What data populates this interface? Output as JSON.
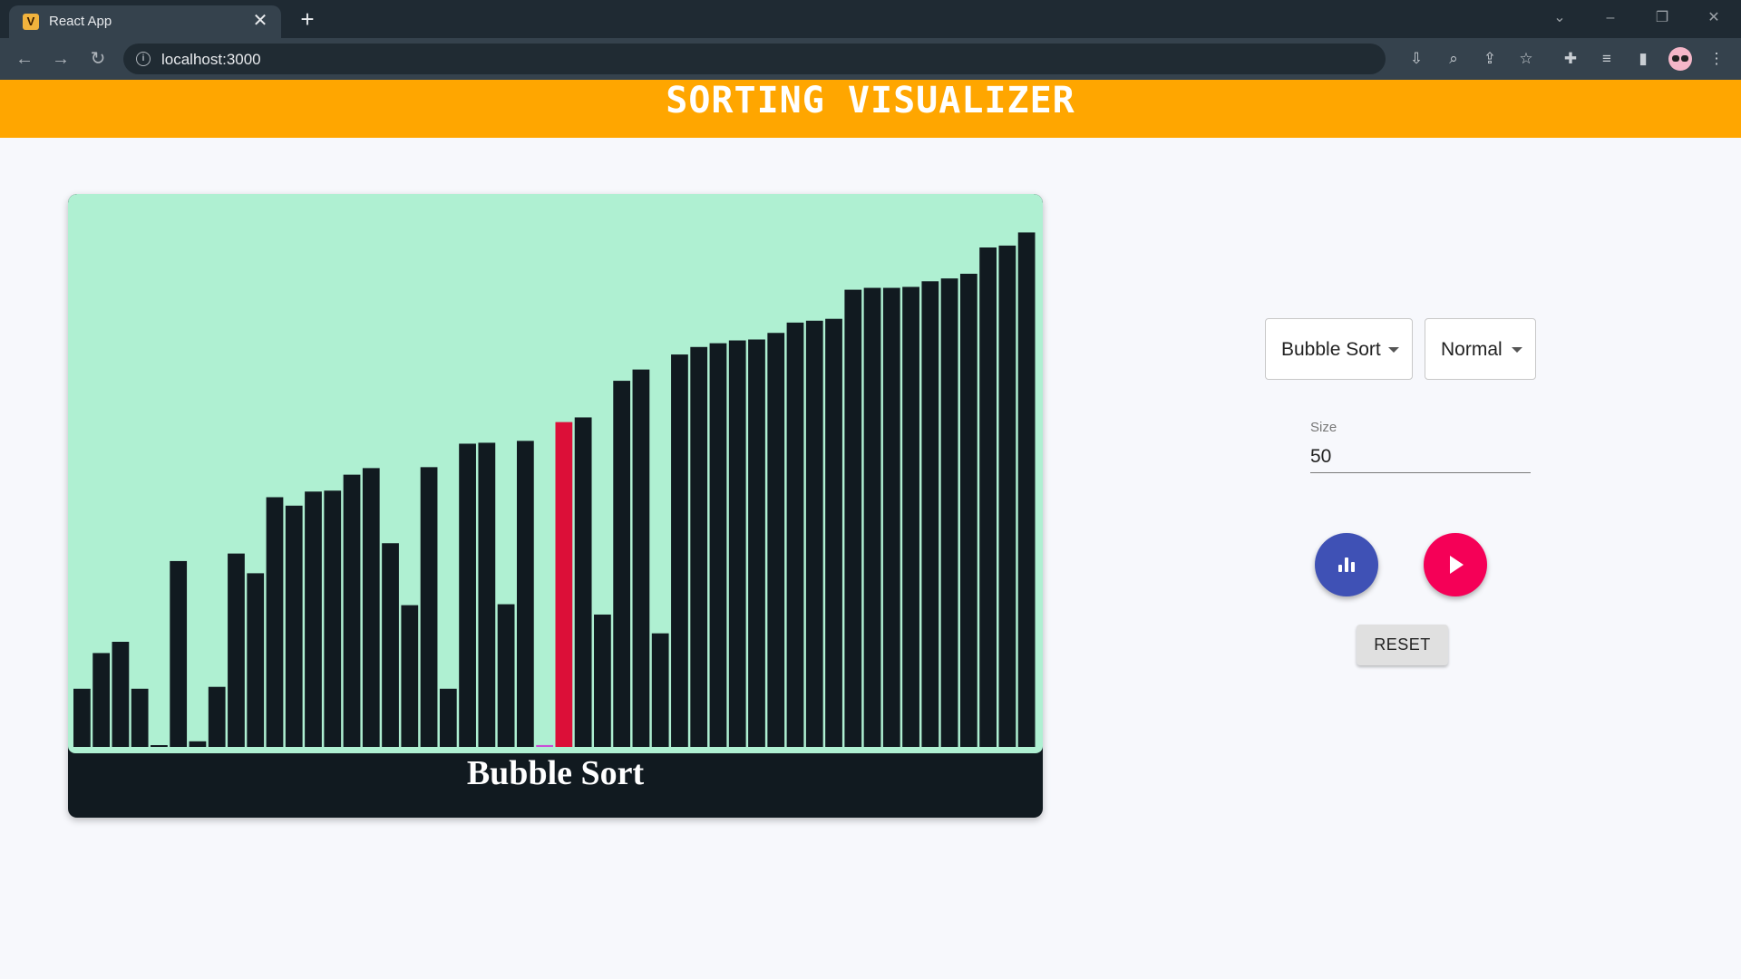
{
  "browser": {
    "tab_title": "React App",
    "tab_favicon_letter": "V",
    "url": "localhost:3000"
  },
  "app": {
    "title": "SORTING VISUALIZER"
  },
  "visualizer": {
    "caption": "Bubble Sort",
    "colors": {
      "background": "#aff0d2",
      "bar": "#111a20",
      "active_bar": "#dc0f38",
      "compare_bar": "#c94fd6",
      "caption_bg": "#111a20"
    },
    "active_index": 25,
    "compare_index": 24
  },
  "chart_data": {
    "type": "bar",
    "values": [
      62,
      100,
      112,
      62,
      0,
      198,
      6,
      64,
      206,
      185,
      266,
      257,
      272,
      273,
      290,
      297,
      217,
      151,
      298,
      62,
      323,
      324,
      152,
      326,
      2,
      346,
      351,
      141,
      390,
      402,
      121,
      418,
      426,
      430,
      433,
      434,
      441,
      452,
      454,
      456,
      487,
      489,
      489,
      490,
      496,
      499,
      504,
      532,
      534,
      548
    ],
    "ylim": [
      0,
      560
    ]
  },
  "controls": {
    "algorithm": {
      "value": "Bubble Sort"
    },
    "speed": {
      "value": "Normal"
    },
    "size": {
      "label": "Size",
      "value": "50"
    },
    "reset_label": "RESET"
  }
}
